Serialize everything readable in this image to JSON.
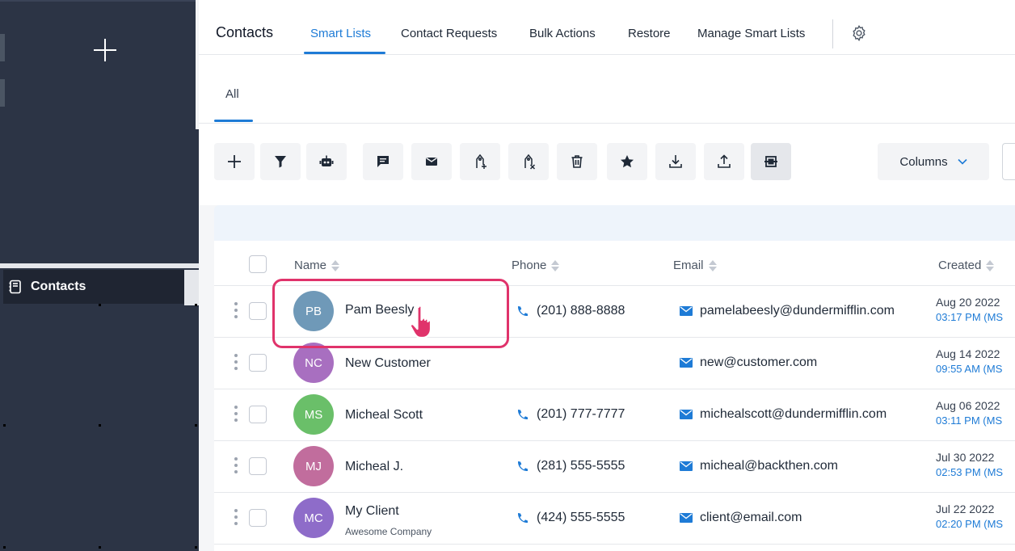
{
  "sidebar": {
    "add_symbol": "+",
    "active_item": {
      "label": "Contacts",
      "icon": "contacts-book-icon"
    }
  },
  "nav": {
    "title": "Contacts",
    "tabs": [
      {
        "label": "Smart Lists",
        "active": true
      },
      {
        "label": "Contact Requests",
        "active": false
      },
      {
        "label": "Bulk Actions",
        "active": false
      },
      {
        "label": "Restore",
        "active": false
      },
      {
        "label": "Manage Smart Lists",
        "active": false
      }
    ],
    "settings_icon": "gear-icon"
  },
  "subtabs": {
    "all_label": "All"
  },
  "toolbar": {
    "icons": [
      "plus-icon",
      "filter-icon",
      "robot-icon",
      "message-icon",
      "email-icon",
      "add-tag-icon",
      "remove-tag-icon",
      "trash-icon",
      "star-icon",
      "import-icon",
      "export-icon",
      "select-box-icon"
    ],
    "columns_label": "Columns"
  },
  "table": {
    "headers": {
      "name": "Name",
      "phone": "Phone",
      "email": "Email",
      "created": "Created"
    },
    "rows": [
      {
        "initials": "PB",
        "name": "Pam Beesly",
        "company": "",
        "phone": "(201) 888-8888",
        "email": "pamelabeesly@dundermifflin.com",
        "date": "Aug 20 2022",
        "time": "03:17 PM (MS",
        "avatar_color": "#6f99b8"
      },
      {
        "initials": "NC",
        "name": "New Customer",
        "company": "",
        "phone": "",
        "email": "new@customer.com",
        "date": "Aug 14 2022",
        "time": "09:55 AM (MS",
        "avatar_color": "#a86fc0"
      },
      {
        "initials": "MS",
        "name": "Micheal Scott",
        "company": "",
        "phone": "(201) 777-7777",
        "email": "michealscott@dundermifflin.com",
        "date": "Aug 06 2022",
        "time": "03:11 PM (MS",
        "avatar_color": "#6abf69"
      },
      {
        "initials": "MJ",
        "name": "Micheal J.",
        "company": "",
        "phone": "(281) 555-5555",
        "email": "micheal@backthen.com",
        "date": "Jul 30 2022",
        "time": "02:53 PM (MS",
        "avatar_color": "#c16d9d"
      },
      {
        "initials": "MC",
        "name": "My Client",
        "company": "Awesome Company",
        "phone": "(424) 555-5555",
        "email": "client@email.com",
        "date": "Jul 22 2022",
        "time": "02:20 PM (MS",
        "avatar_color": "#8e6cc9"
      }
    ]
  },
  "colors": {
    "accent": "#1e7bd6",
    "highlight": "#e0336b",
    "sidebar": "#2c3445"
  }
}
